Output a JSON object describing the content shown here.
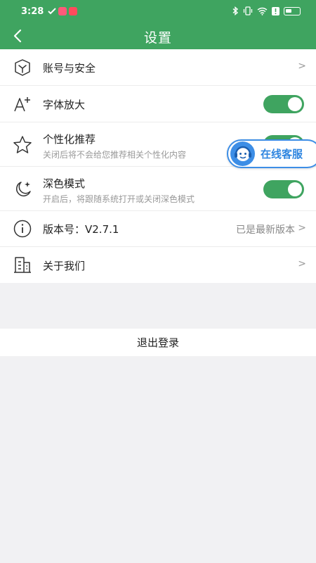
{
  "status_bar": {
    "time": "3:28"
  },
  "header": {
    "title": "设置"
  },
  "settings": [
    {
      "label": "账号与安全"
    },
    {
      "label": "字体放大"
    },
    {
      "label": "个性化推荐",
      "subtitle": "关闭后将不会给您推荐相关个性化内容"
    },
    {
      "label": "深色模式",
      "subtitle": "开启后，将跟随系统打开或关闭深色模式"
    },
    {
      "label": "版本号：V2.7.1",
      "value": "已是最新版本"
    },
    {
      "label": "关于我们"
    }
  ],
  "chevron": ">",
  "customer_service": {
    "label": "在线客服"
  },
  "logout": {
    "label": "退出登录"
  },
  "colors": {
    "brand": "#3fa460",
    "cs_blue": "#3d8ee6"
  },
  "icons": [
    "back-arrow-icon",
    "shield-icon",
    "font-size-icon",
    "star-icon",
    "moon-icon",
    "info-icon",
    "building-icon",
    "customer-service-icon"
  ]
}
